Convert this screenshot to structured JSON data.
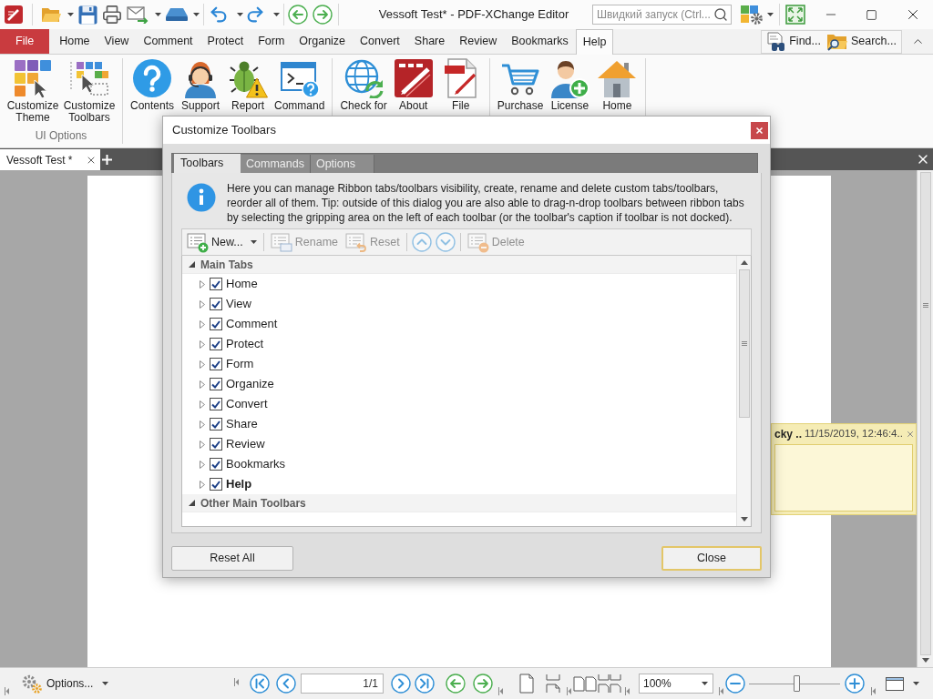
{
  "title_bar": {
    "title": "Vessoft Test* - PDF-XChange Editor",
    "quick_launch": {
      "placeholder": "Швидкий запуск (Ctrl..."
    }
  },
  "menu_tabs": [
    {
      "label": "File",
      "kind": "file",
      "selected": false
    },
    {
      "label": "Home",
      "kind": "tab",
      "selected": false
    },
    {
      "label": "View",
      "kind": "tab",
      "selected": false
    },
    {
      "label": "Comment",
      "kind": "tab",
      "selected": false
    },
    {
      "label": "Protect",
      "kind": "tab",
      "selected": false
    },
    {
      "label": "Form",
      "kind": "tab",
      "selected": false
    },
    {
      "label": "Organize",
      "kind": "tab",
      "selected": false
    },
    {
      "label": "Convert",
      "kind": "tab",
      "selected": false
    },
    {
      "label": "Share",
      "kind": "tab",
      "selected": false
    },
    {
      "label": "Review",
      "kind": "tab",
      "selected": false
    },
    {
      "label": "Bookmarks",
      "kind": "tab",
      "selected": false
    },
    {
      "label": "Help",
      "kind": "tab",
      "selected": true
    }
  ],
  "menu_actions": [
    {
      "label": "Find..."
    },
    {
      "label": "Search..."
    }
  ],
  "ribbon": {
    "groups": [
      {
        "label": "UI Options",
        "items": [
          {
            "label": "Customize Theme"
          },
          {
            "label": "Customize Toolbars"
          }
        ]
      },
      {
        "items": [
          {
            "label": "Contents"
          },
          {
            "label": "Support"
          },
          {
            "label": "Report"
          },
          {
            "label": "Command"
          }
        ]
      },
      {
        "items": [
          {
            "label": "Check for"
          },
          {
            "label": "About"
          },
          {
            "label": "File"
          }
        ]
      },
      {
        "items": [
          {
            "label": "Purchase"
          },
          {
            "label": "License"
          },
          {
            "label": "Home"
          }
        ]
      }
    ]
  },
  "document_tabs": [
    {
      "label": "Vessoft Test *",
      "selected": true
    }
  ],
  "sticky_note": {
    "author": "cky ..",
    "date": "11/15/2019, 12:46:4.."
  },
  "dialog": {
    "title": "Customize Toolbars",
    "tabs": [
      {
        "label": "Toolbars",
        "selected": true
      },
      {
        "label": "Commands",
        "selected": false
      },
      {
        "label": "Options",
        "selected": false
      }
    ],
    "info": "Here you can manage Ribbon tabs/toolbars visibility, create, rename and delete custom tabs/toolbars, reorder all of them. Tip: outside of this dialog you are also able to drag-n-drop toolbars between ribbon tabs by selecting the gripping area on the left of each toolbar (or the toolbar's caption if toolbar is not docked).",
    "toolbar_groups": [
      {
        "items": [
          {
            "kind": "new",
            "label": "New...",
            "disabled": false,
            "dropdown": true
          }
        ]
      },
      {
        "items": [
          {
            "kind": "rename",
            "label": "Rename",
            "disabled": true
          },
          {
            "kind": "reset",
            "label": "Reset",
            "disabled": true
          }
        ]
      },
      {
        "items": [
          {
            "kind": "move_up",
            "disabled": true
          },
          {
            "kind": "move_down",
            "disabled": true
          }
        ]
      },
      {
        "items": [
          {
            "kind": "delete",
            "label": "Delete",
            "disabled": true
          }
        ]
      }
    ],
    "tree": [
      {
        "label": "Main Tabs",
        "expanded": true,
        "children": [
          {
            "label": "Home",
            "checked": true,
            "expanded": false,
            "current": false
          },
          {
            "label": "View",
            "checked": true,
            "expanded": false,
            "current": false
          },
          {
            "label": "Comment",
            "checked": true,
            "expanded": false,
            "current": false
          },
          {
            "label": "Protect",
            "checked": true,
            "expanded": false,
            "current": false
          },
          {
            "label": "Form",
            "checked": true,
            "expanded": false,
            "current": false
          },
          {
            "label": "Organize",
            "checked": true,
            "expanded": false,
            "current": false
          },
          {
            "label": "Convert",
            "checked": true,
            "expanded": false,
            "current": false
          },
          {
            "label": "Share",
            "checked": true,
            "expanded": false,
            "current": false
          },
          {
            "label": "Review",
            "checked": true,
            "expanded": false,
            "current": false
          },
          {
            "label": "Bookmarks",
            "checked": true,
            "expanded": false,
            "current": false
          },
          {
            "label": "Help",
            "checked": true,
            "expanded": false,
            "current": true
          }
        ]
      },
      {
        "label": "Other Main Toolbars",
        "expanded": true
      }
    ],
    "buttons": [
      {
        "label": "Reset All",
        "default": false
      },
      {
        "label": "Close",
        "default": true
      }
    ]
  },
  "status_bar": {
    "options_button": "Options...",
    "page": "1/1",
    "zoom": "100%",
    "zoom_slider": {
      "level": 0.52
    }
  }
}
